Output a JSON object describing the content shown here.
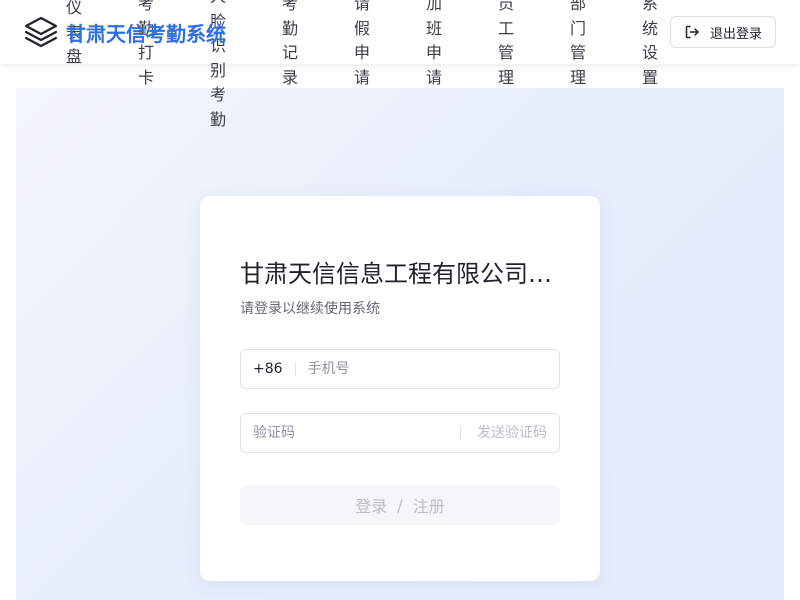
{
  "header": {
    "brand": "甘肃天信考勤系统",
    "nav": [
      {
        "id": "dashboard",
        "label": "仪表盘"
      },
      {
        "id": "checkin",
        "label": "考勤打卡"
      },
      {
        "id": "face",
        "label": "人脸识别考勤"
      },
      {
        "id": "records",
        "label": "考勤记录"
      },
      {
        "id": "leave",
        "label": "请假申请"
      },
      {
        "id": "overtime",
        "label": "加班申请"
      },
      {
        "id": "staff",
        "label": "员工管理"
      },
      {
        "id": "dept",
        "label": "部门管理"
      },
      {
        "id": "settings",
        "label": "系统设置"
      }
    ],
    "logout_label": "退出登录",
    "icons": {
      "logo": "layers-icon",
      "logout": "logout-icon"
    }
  },
  "login": {
    "title": "甘肃天信信息工程有限公司考勤系统",
    "subtitle": "请登录以继续使用系统",
    "phone_prefix": "+86",
    "phone_placeholder": "手机号",
    "code_placeholder": "验证码",
    "send_code_label": "发送验证码",
    "submit_login": "登录",
    "submit_separator": "/",
    "submit_register": "注册"
  },
  "colors": {
    "brand": "#2f6fe4",
    "page_bg": "#eef2fc",
    "disabled": "#bbbfc4"
  }
}
